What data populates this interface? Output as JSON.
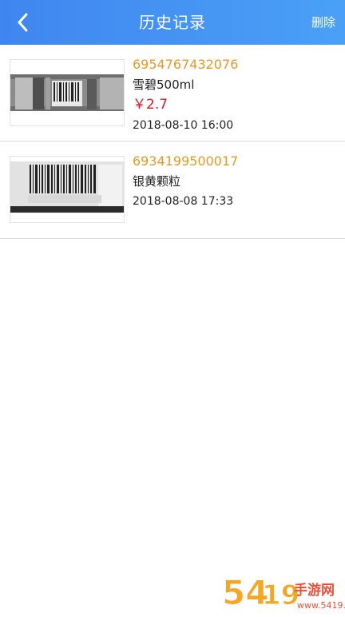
{
  "header": {
    "title": "历史记录",
    "delete_label": "删除"
  },
  "history": [
    {
      "barcode": "6954767432076",
      "name": "雪碧500ml",
      "price": "￥2.7",
      "time": "2018-08-10 16:00"
    },
    {
      "barcode": "6934199500017",
      "name": "银黄颗粒",
      "time": "2018-08-08 17:33"
    }
  ],
  "watermark": {
    "text": "5419手游网",
    "domain": "www.5419.cn"
  },
  "colors": {
    "header_start": "#3f86f0",
    "header_end": "#4aa0f6",
    "barcode": "#e59a25",
    "price": "#e3162b"
  },
  "icons": {
    "back": "chevron-left-icon"
  }
}
